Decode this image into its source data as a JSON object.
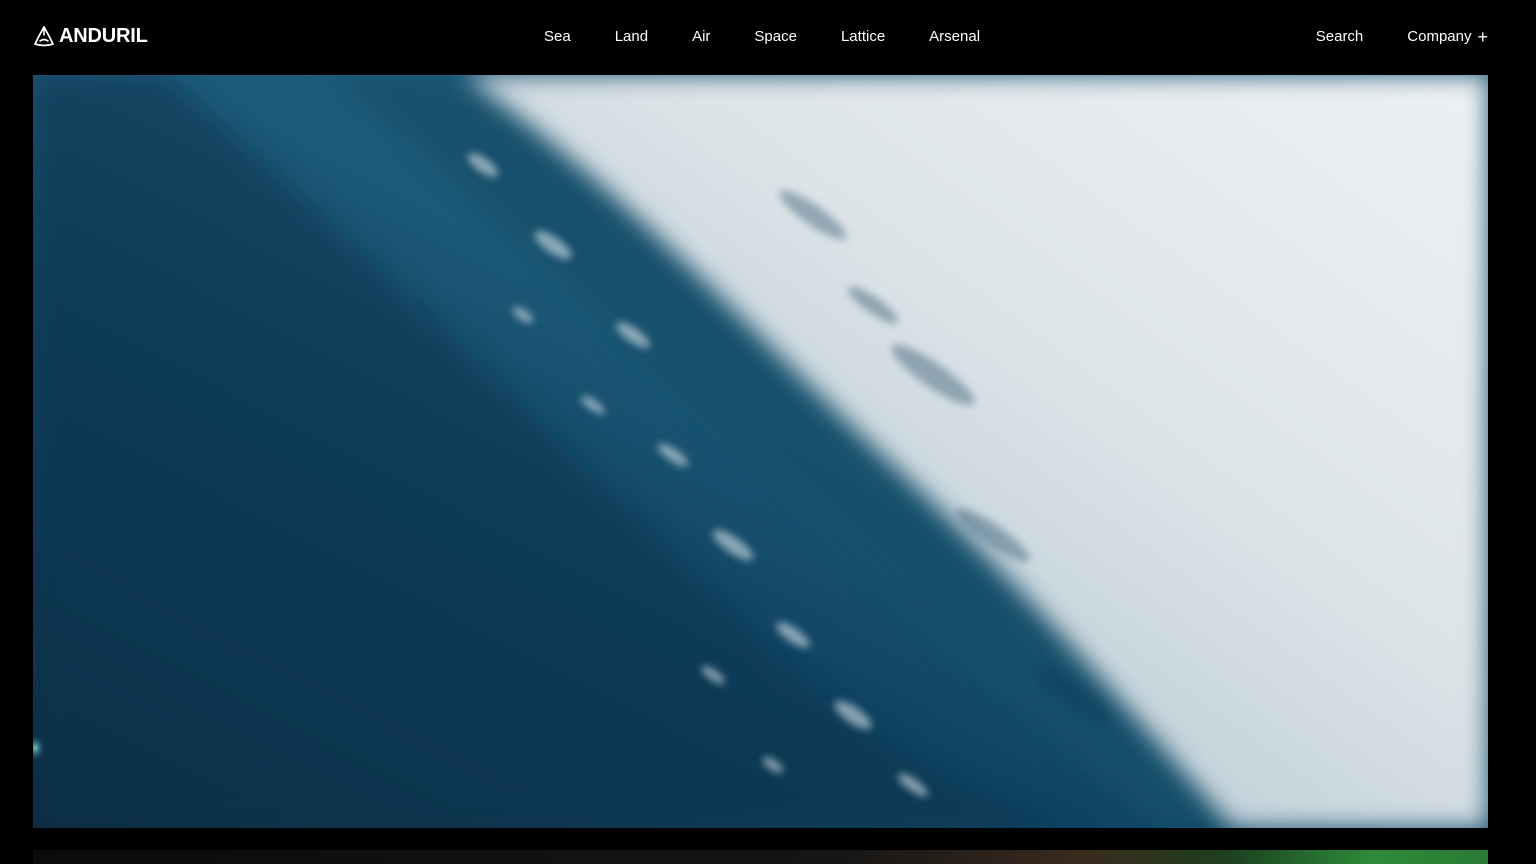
{
  "header": {
    "logo_text": "ANDURIL",
    "logo_icon": "anduril-logo-icon",
    "nav": [
      {
        "label": "Sea"
      },
      {
        "label": "Land"
      },
      {
        "label": "Air"
      },
      {
        "label": "Space"
      },
      {
        "label": "Lattice"
      },
      {
        "label": "Arsenal"
      }
    ],
    "search_label": "Search",
    "company_label": "Company",
    "company_icon": "plus-icon"
  },
  "hero": {
    "media": "underwater-ocean-surface-video"
  },
  "colors": {
    "background": "#000000",
    "text": "#ffffff",
    "water_deep": "#0e3a55",
    "water_surface": "#e6ebee"
  }
}
